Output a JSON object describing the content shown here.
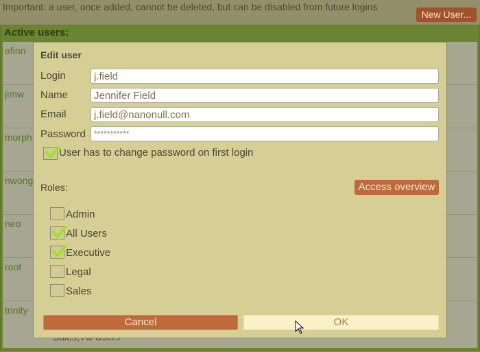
{
  "notice": {
    "text": "Important: a user, once added, cannot be deleted, but can be disabled from future logins"
  },
  "toolbar": {
    "new_user_label": "New User..."
  },
  "users_panel": {
    "header": "Active users:",
    "users": [
      {
        "login": "afinn"
      },
      {
        "login": "jimw"
      },
      {
        "login": "morph"
      },
      {
        "login": "nwong"
      },
      {
        "login": "neo"
      },
      {
        "login": "root"
      },
      {
        "login": "trinity",
        "roles_text": "Sales, All Users"
      }
    ]
  },
  "dialog": {
    "title": "Edit user",
    "fields": {
      "login": {
        "label": "Login",
        "value": "j.field"
      },
      "name": {
        "label": "Name",
        "value": "Jennifer Field"
      },
      "email": {
        "label": "Email",
        "value": "j.field@nanonull.com"
      },
      "password": {
        "label": "Password",
        "value": "***********"
      }
    },
    "change_password": {
      "label": "User has to change password on first login",
      "checked": true
    },
    "roles_label": "Roles:",
    "access_overview_label": "Access overview",
    "roles": [
      {
        "label": "Admin",
        "checked": false
      },
      {
        "label": "All Users",
        "checked": true
      },
      {
        "label": "Executive",
        "checked": true
      },
      {
        "label": "Legal",
        "checked": false
      },
      {
        "label": "Sales",
        "checked": false
      }
    ],
    "cancel_label": "Cancel",
    "ok_label": "OK"
  },
  "colors": {
    "accent_button": "#c0693a",
    "header_green": "#6b8434",
    "check_green": "#9be22a",
    "dialog_bg": "#d5cf96"
  }
}
